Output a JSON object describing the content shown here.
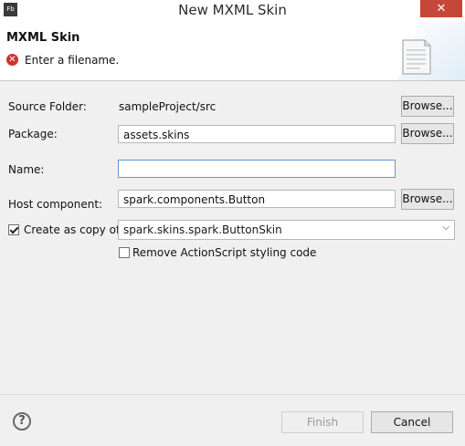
{
  "window": {
    "app_icon": "Fb",
    "title": "New MXML Skin",
    "close_icon": "✕"
  },
  "header": {
    "title": "MXML Skin",
    "message": "Enter a filename.",
    "error_icon": "✕"
  },
  "form": {
    "source_folder_label": "Source Folder:",
    "source_folder_value": "sampleProject/src",
    "package_label": "Package:",
    "package_value": "assets.skins",
    "name_label": "Name:",
    "name_value": "",
    "host_component_label": "Host component:",
    "host_component_value": "spark.components.Button",
    "create_copy_label": "Create as copy of:",
    "create_copy_checked": true,
    "create_copy_value": "spark.skins.spark.ButtonSkin",
    "remove_as_label": "Remove ActionScript styling code",
    "remove_as_checked": false,
    "browse_label": "Browse..."
  },
  "footer": {
    "help_icon": "?",
    "finish_label": "Finish",
    "cancel_label": "Cancel"
  }
}
